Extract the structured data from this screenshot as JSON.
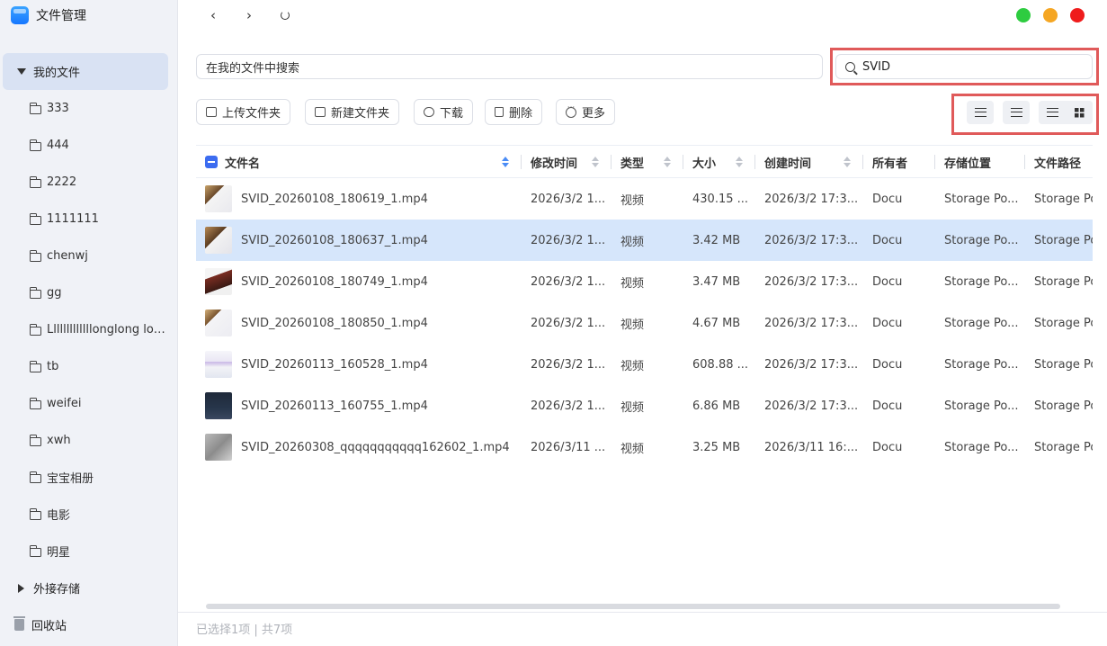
{
  "app": {
    "title": "文件管理"
  },
  "sidebar": {
    "root_label": "我的文件",
    "folders": [
      "333",
      "444",
      "2222",
      "1111111",
      "chenwj",
      "gg",
      "Lllllllllllllonglong lon...",
      "tb",
      "weifei",
      "xwh",
      "宝宝相册",
      "电影",
      "明星"
    ],
    "external_label": "外接存储",
    "trash_label": "回收站"
  },
  "search": {
    "scope_placeholder": "在我的文件中搜索",
    "query": "SVID"
  },
  "toolbar": {
    "upload_label": "上传文件夹",
    "new_folder_label": "新建文件夹",
    "download_label": "下载",
    "delete_label": "删除",
    "more_label": "更多"
  },
  "window_controls": {
    "colors": [
      "#2ecc40",
      "#f5a623",
      "#ef1c1c"
    ]
  },
  "table": {
    "columns": [
      "文件名",
      "修改时间",
      "类型",
      "大小",
      "创建时间",
      "所有者",
      "存储位置",
      "文件路径"
    ],
    "rows": [
      [
        "SVID_20260108_180619_1.mp4",
        "2026/3/2 1...",
        "视频",
        "430.15 ...",
        "2026/3/2 17:3...",
        "Docu",
        "Storage Po...",
        "Storage Po"
      ],
      [
        "SVID_20260108_180637_1.mp4",
        "2026/3/2 1...",
        "视频",
        "3.42 MB",
        "2026/3/2 17:3...",
        "Docu",
        "Storage Po...",
        "Storage Po"
      ],
      [
        "SVID_20260108_180749_1.mp4",
        "2026/3/2 1...",
        "视频",
        "3.47 MB",
        "2026/3/2 17:3...",
        "Docu",
        "Storage Po...",
        "Storage Po"
      ],
      [
        "SVID_20260108_180850_1.mp4",
        "2026/3/2 1...",
        "视频",
        "4.67 MB",
        "2026/3/2 17:3...",
        "Docu",
        "Storage Po...",
        "Storage Po"
      ],
      [
        "SVID_20260113_160528_1.mp4",
        "2026/3/2 1...",
        "视频",
        "608.88 ...",
        "2026/3/2 17:3...",
        "Docu",
        "Storage Po...",
        "Storage Po"
      ],
      [
        "SVID_20260113_160755_1.mp4",
        "2026/3/2 1...",
        "视频",
        "6.86 MB",
        "2026/3/2 17:3...",
        "Docu",
        "Storage Po...",
        "Storage Po"
      ],
      [
        "SVID_20260308_qqqqqqqqqqq162602_1.mp4",
        "2026/3/11 ...",
        "视频",
        "3.25 MB",
        "2026/3/11 16:...",
        "Docu",
        "Storage Po...",
        "Storage Po"
      ]
    ],
    "selected_row": 1
  },
  "footer": {
    "status": "已选择1项 | 共7项"
  }
}
